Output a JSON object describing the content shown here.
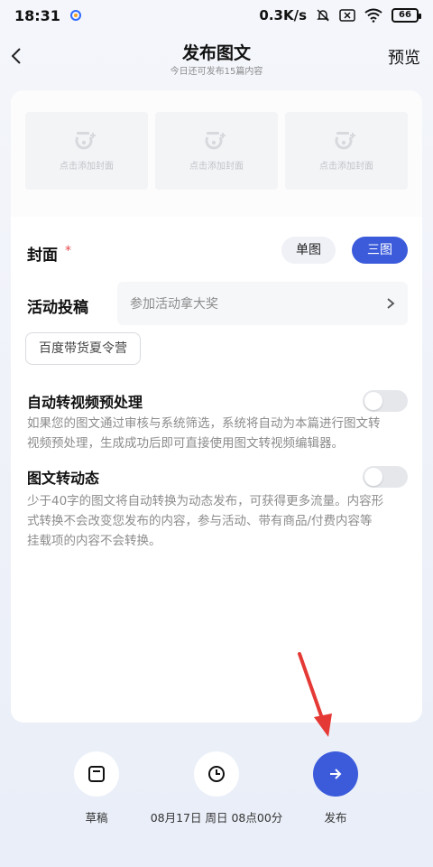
{
  "status_bar": {
    "time": "18:31",
    "network_speed": "0.3K/s",
    "battery": "66"
  },
  "header": {
    "title": "发布图文",
    "subtitle": "今日还可发布15篇内容",
    "preview_label": "预览"
  },
  "covers": [
    {
      "label": "点击添加封面"
    },
    {
      "label": "点击添加封面"
    },
    {
      "label": "点击添加封面"
    }
  ],
  "cover_setting": {
    "label": "封面",
    "required_mark": "*",
    "single_label": "单图",
    "triple_label": "三图",
    "selected": "三图"
  },
  "activity": {
    "label": "活动投稿",
    "placeholder": "参加活动拿大奖",
    "tag": "百度带货夏令营"
  },
  "auto_video": {
    "title": "自动转视频预处理",
    "enabled": false,
    "desc_line1": "如果您的图文通过审核与系统筛选，系统将自动为本篇进行图文转",
    "desc_line2": "视频预处理，生成成功后即可直接使用图文转视频编辑器。"
  },
  "to_dynamic": {
    "title": "图文转动态",
    "enabled": false,
    "desc_line1": "少于40字的图文将自动转换为动态发布，可获得更多流量。内容形",
    "desc_line2": "式转换不会改变您发布的内容，参与活动、带有商品/付费内容等",
    "desc_line3": "挂载项的内容不会转换。"
  },
  "bottom": {
    "draft_label": "草稿",
    "schedule_label": "08月17日 周日 08点00分",
    "publish_label": "发布"
  },
  "colors": {
    "accent": "#3b5bdb",
    "annotation": "#e53935"
  }
}
